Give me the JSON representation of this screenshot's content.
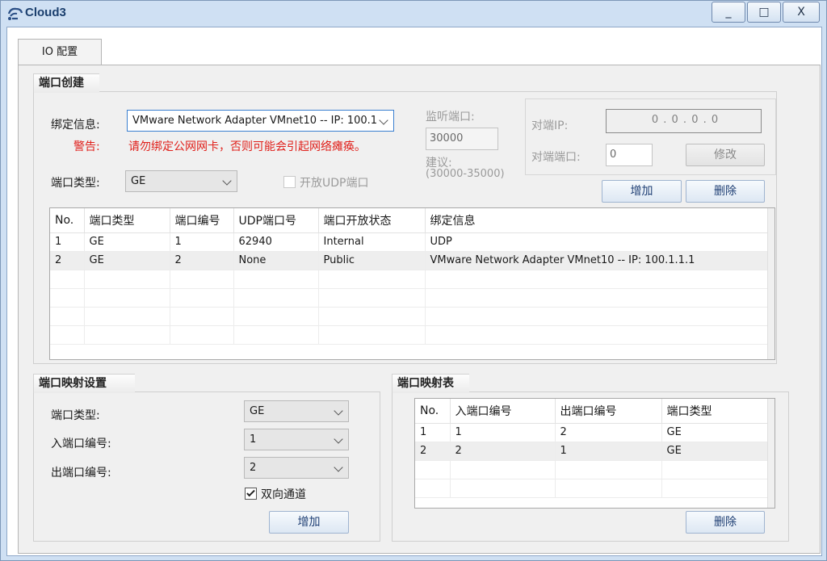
{
  "window": {
    "title": "Cloud3",
    "icon": "cloud-app-icon",
    "controls": {
      "minimize": "_",
      "maximize": "□",
      "close": "X"
    }
  },
  "tabs": [
    {
      "label": "IO 配置",
      "active": true
    }
  ],
  "port_creation": {
    "title": "端口创建",
    "binding_label": "绑定信息:",
    "binding_value": "VMware Network Adapter VMnet10 -- IP: 100.1",
    "warning_label": "警告:",
    "warning_text": "请勿绑定公网网卡，否则可能会引起网络瘫痪。",
    "port_type_label": "端口类型:",
    "port_type_value": "GE",
    "open_udp_label": "开放UDP端口",
    "open_udp_checked": false,
    "listen_port_label": "监听端口:",
    "listen_port_value": "30000",
    "suggest_label": "建议:",
    "suggest_range": "(30000-35000)",
    "peer_ip_label": "对端IP:",
    "peer_ip_value": "0 . 0 . 0 . 0",
    "peer_port_label": "对端端口:",
    "peer_port_value": "0",
    "modify_button": "修改",
    "add_button": "增加",
    "delete_button": "删除",
    "table": {
      "columns": [
        "No.",
        "端口类型",
        "端口编号",
        "UDP端口号",
        "端口开放状态",
        "绑定信息"
      ],
      "rows": [
        [
          "1",
          "GE",
          "1",
          "62940",
          "Internal",
          "UDP"
        ],
        [
          "2",
          "GE",
          "2",
          "None",
          "Public",
          "VMware Network Adapter VMnet10 -- IP: 100.1.1.1"
        ]
      ]
    }
  },
  "port_mapping_settings": {
    "title": "端口映射设置",
    "port_type_label": "端口类型:",
    "port_type_value": "GE",
    "in_port_label": "入端口编号:",
    "in_port_value": "1",
    "out_port_label": "出端口编号:",
    "out_port_value": "2",
    "bidirectional_label": "双向通道",
    "bidirectional_checked": true,
    "add_button": "增加"
  },
  "port_mapping_table": {
    "title": "端口映射表",
    "columns": [
      "No.",
      "入端口编号",
      "出端口编号",
      "端口类型"
    ],
    "rows": [
      [
        "1",
        "1",
        "2",
        "GE"
      ],
      [
        "2",
        "2",
        "1",
        "GE"
      ]
    ],
    "delete_button": "删除"
  }
}
